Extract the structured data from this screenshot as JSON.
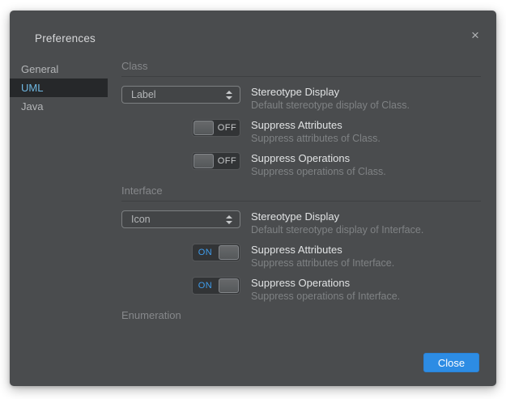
{
  "dialog": {
    "title": "Preferences"
  },
  "icons": {
    "close_glyph": "×"
  },
  "sidebar": {
    "items": [
      {
        "label": "General",
        "selected": false
      },
      {
        "label": "UML",
        "selected": true
      },
      {
        "label": "Java",
        "selected": false
      }
    ]
  },
  "sections": [
    {
      "title": "Class",
      "rows": [
        {
          "type": "select",
          "value": "Label",
          "label": "Stereotype Display",
          "description": "Default stereotype display of Class."
        },
        {
          "type": "toggle",
          "state": "OFF",
          "label": "Suppress Attributes",
          "description": "Suppress attributes of Class."
        },
        {
          "type": "toggle",
          "state": "OFF",
          "label": "Suppress Operations",
          "description": "Suppress operations of Class."
        }
      ]
    },
    {
      "title": "Interface",
      "rows": [
        {
          "type": "select",
          "value": "Icon",
          "label": "Stereotype Display",
          "description": "Default stereotype display of Interface."
        },
        {
          "type": "toggle",
          "state": "ON",
          "label": "Suppress Attributes",
          "description": "Suppress attributes of Interface."
        },
        {
          "type": "toggle",
          "state": "ON",
          "label": "Suppress Operations",
          "description": "Suppress operations of Interface."
        }
      ]
    },
    {
      "title": "Enumeration",
      "rows": []
    }
  ],
  "footer": {
    "close_button": "Close"
  },
  "colors": {
    "dialog_bg": "#4a4c4e",
    "accent_blue": "#2d8ce4",
    "toggle_on_text": "#3f9ded",
    "sidebar_selected_text": "#6fb8e2"
  }
}
